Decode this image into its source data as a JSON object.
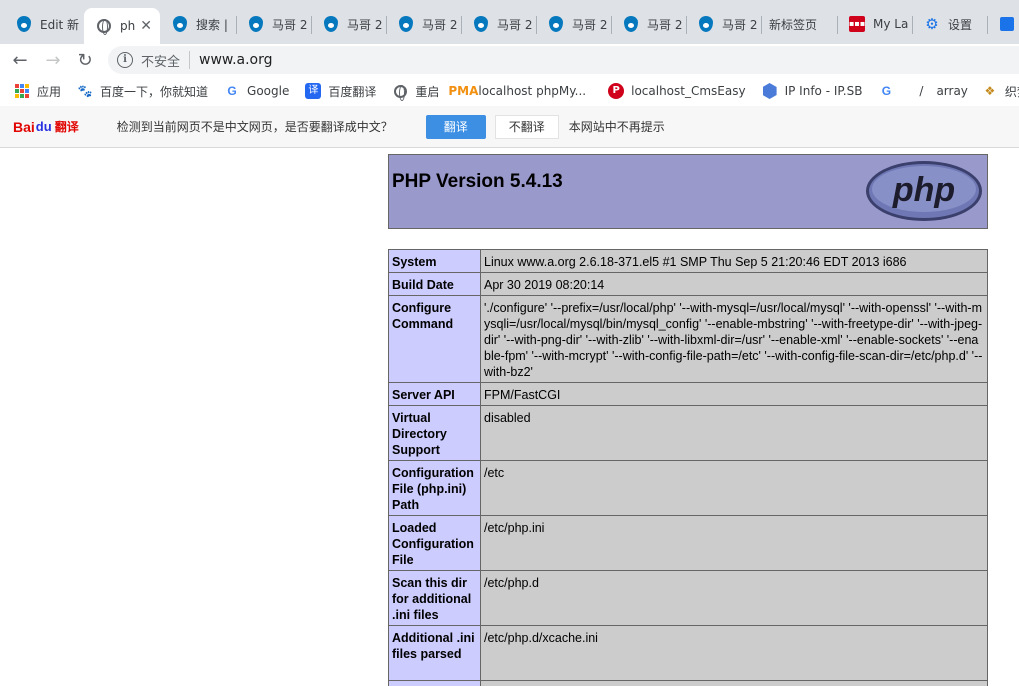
{
  "tabs": [
    {
      "favicon": "drupal-icon",
      "label": "Edit 新",
      "active": false
    },
    {
      "favicon": "globe-icon",
      "label": "ph",
      "active": true
    },
    {
      "favicon": "drupal-icon",
      "label": "搜索 |",
      "active": false
    },
    {
      "favicon": "drupal-icon",
      "label": "马哥 2",
      "active": false
    },
    {
      "favicon": "drupal-icon",
      "label": "马哥 2",
      "active": false
    },
    {
      "favicon": "drupal-icon",
      "label": "马哥 2",
      "active": false
    },
    {
      "favicon": "drupal-icon",
      "label": "马哥 2",
      "active": false
    },
    {
      "favicon": "drupal-icon",
      "label": "马哥 2",
      "active": false
    },
    {
      "favicon": "drupal-icon",
      "label": "马哥 2",
      "active": false
    },
    {
      "favicon": "drupal-icon",
      "label": "马哥 2",
      "active": false
    },
    {
      "favicon": "",
      "label": "新标签页",
      "active": false
    },
    {
      "favicon": "mylast-icon",
      "label": "My La",
      "active": false
    },
    {
      "favicon": "gear-icon",
      "label": "设置",
      "active": false
    },
    {
      "favicon": "puzzle-icon",
      "label": "",
      "active": false
    }
  ],
  "toolbar": {
    "security_text": "不安全",
    "url": "www.a.org"
  },
  "bookmarks": [
    {
      "icon": "apps-grid-icon",
      "label": "应用"
    },
    {
      "icon": "baidu-paw-icon",
      "label": "百度一下，你就知道"
    },
    {
      "icon": "google-icon",
      "label": "Google"
    },
    {
      "icon": "baidu-fanyi-icon",
      "label": "百度翻译"
    },
    {
      "icon": "globe-icon",
      "label": "重启"
    },
    {
      "icon": "phpmyadmin-icon",
      "label": "localhost phpMy..."
    },
    {
      "icon": "p-logo-icon",
      "label": "localhost_CmsEasy"
    },
    {
      "icon": "ipinfo-icon",
      "label": "IP Info - IP.SB"
    },
    {
      "icon": "google-icon",
      "label": ""
    },
    {
      "icon": "slash-icon",
      "label": "array"
    },
    {
      "icon": "zhi-icon",
      "label": "织梦"
    }
  ],
  "translate_bar": {
    "logo_bai": "Bai",
    "logo_du": "du",
    "logo_fanyi": "翻译",
    "message": "检测到当前网页不是中文网页，是否要翻译成中文？",
    "translate_button": "翻译",
    "no_translate_button": "不翻译",
    "never_link": "本网站中不再提示"
  },
  "php": {
    "title": "PHP Version 5.4.13",
    "logo_text": "php",
    "rows": [
      {
        "key": "System",
        "value": "Linux www.a.org 2.6.18-371.el5 #1 SMP Thu Sep 5 21:20:46 EDT 2013 i686"
      },
      {
        "key": "Build Date",
        "value": "Apr 30 2019 08:20:14"
      },
      {
        "key": "Configure Command",
        "value": "'./configure' '--prefix=/usr/local/php' '--with-mysql=/usr/local/mysql' '--with-openssl' '--with-mysqli=/usr/local/mysql/bin/mysql_config' '--enable-mbstring' '--with-freetype-dir' '--with-jpeg-dir' '--with-png-dir' '--with-zlib' '--with-libxml-dir=/usr' '--enable-xml' '--enable-sockets' '--enable-fpm' '--with-mcrypt' '--with-config-file-path=/etc' '--with-config-file-scan-dir=/etc/php.d' '--with-bz2'"
      },
      {
        "key": "Server API",
        "value": "FPM/FastCGI"
      },
      {
        "key": "Virtual Directory Support",
        "value": "disabled"
      },
      {
        "key": "Configuration File (php.ini) Path",
        "value": "/etc"
      },
      {
        "key": "Loaded Configuration File",
        "value": "/etc/php.ini"
      },
      {
        "key": "Scan this dir for additional .ini files",
        "value": "/etc/php.d"
      },
      {
        "key": "Additional .ini files parsed",
        "value": "/etc/php.d/xcache.ini"
      },
      {
        "key": "",
        "value": ""
      }
    ]
  }
}
